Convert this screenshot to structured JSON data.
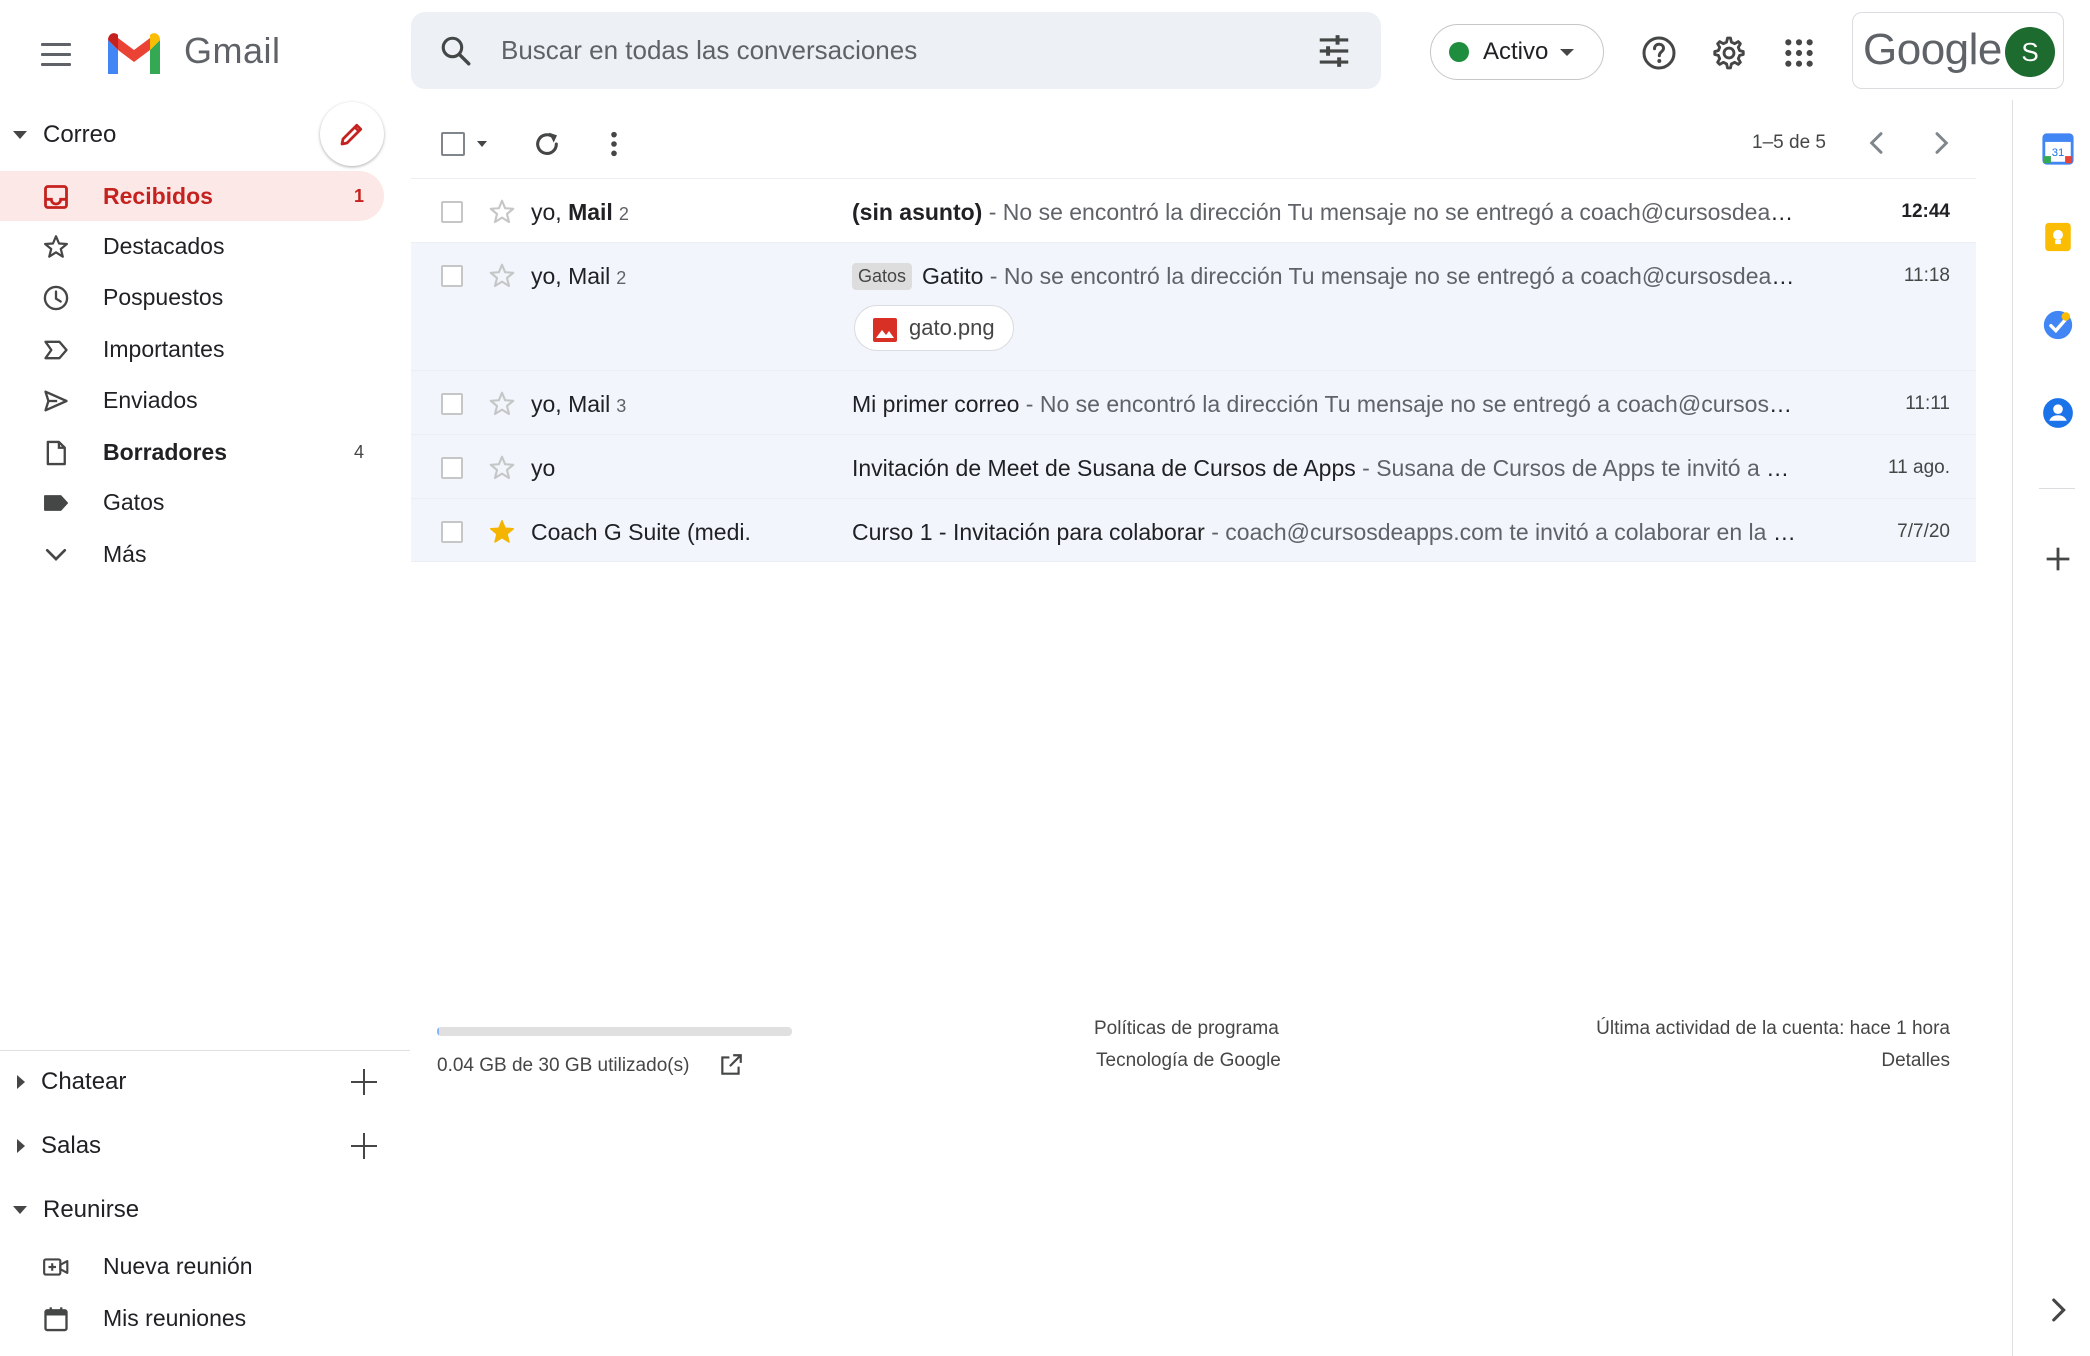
{
  "header": {
    "brand": "Gmail",
    "search_placeholder": "Buscar en todas las conversaciones",
    "status_label": "Activo",
    "account_word": "Google",
    "avatar_letter": "S"
  },
  "nav": {
    "mail_section": "Correo",
    "items": [
      {
        "label": "Recibidos",
        "count": "1"
      },
      {
        "label": "Destacados",
        "count": ""
      },
      {
        "label": "Pospuestos",
        "count": ""
      },
      {
        "label": "Importantes",
        "count": ""
      },
      {
        "label": "Enviados",
        "count": ""
      },
      {
        "label": "Borradores",
        "count": "4"
      },
      {
        "label": "Gatos",
        "count": ""
      },
      {
        "label": "Más",
        "count": ""
      }
    ],
    "chat_section": "Chatear",
    "rooms_section": "Salas",
    "meet_section": "Reunirse",
    "meet_items": [
      {
        "label": "Nueva reunión"
      },
      {
        "label": "Mis reuniones"
      }
    ]
  },
  "toolbar": {
    "pager": "1–5 de 5"
  },
  "emails": [
    {
      "sender": "yo, ",
      "sender_bold": "Mail",
      "count": "2",
      "label": "",
      "subject": "(sin asunto)",
      "snippet": " - No se encontró la dirección Tu mensaje no se entregó a coach@cursosdeapps.com porque no se encontró la dirección",
      "time": "12:44",
      "unread": true,
      "starred": false,
      "attachment": ""
    },
    {
      "sender": "yo, Mail",
      "sender_bold": "",
      "count": "2",
      "label": "Gatos",
      "subject": "Gatito",
      "snippet": " - No se encontró la dirección Tu mensaje no se entregó a coach@cursosdeapps.com porque no se encontró",
      "time": "11:18",
      "unread": false,
      "starred": false,
      "attachment": "gato.png"
    },
    {
      "sender": "yo, Mail",
      "sender_bold": "",
      "count": "3",
      "label": "",
      "subject": "Mi primer correo",
      "snippet": " - No se encontró la dirección Tu mensaje no se entregó a coach@cursosdeapps.com porque",
      "time": "11:11",
      "unread": false,
      "starred": false,
      "attachment": ""
    },
    {
      "sender": "yo",
      "sender_bold": "",
      "count": "",
      "label": "",
      "subject": "Invitación de Meet de Susana de Cursos de Apps",
      "snippet": " - Susana de Cursos de Apps te invitó a unirte a una reunión",
      "time": "11 ago.",
      "unread": false,
      "starred": false,
      "attachment": ""
    },
    {
      "sender": "Coach G Suite (medi.",
      "sender_bold": "",
      "count": "",
      "label": "",
      "subject": "Curso 1 - Invitación para colaborar",
      "snippet": " - coach@cursosdeapps.com te invitó a colaborar en la siguiente hoja",
      "time": "7/7/20",
      "unread": false,
      "starred": true,
      "attachment": ""
    }
  ],
  "footer": {
    "storage_text": "0.04 GB de 30 GB utilizado(s)",
    "storage_used_fraction": 0.0013,
    "program_policies": "Políticas de programa",
    "google_tech": "Tecnología de Google",
    "last_activity": "Última actividad de la cuenta: hace 1 hora",
    "details": "Detalles"
  },
  "sidepanel": {
    "calendar_day": "31"
  },
  "colors": {
    "accent_red": "#c5221f",
    "active_bg": "#fce8e6",
    "status_green": "#1e8e3e",
    "avatar_green": "#1e6b2f",
    "star_yellow": "#f4b400"
  },
  "icons": [
    "menu-icon",
    "search-icon",
    "tune-icon",
    "help-icon",
    "settings-icon",
    "apps-icon",
    "edit-icon",
    "inbox-icon",
    "star-icon",
    "clock-icon",
    "important-icon",
    "send-icon",
    "draft-icon",
    "label-icon",
    "chevron-down-icon",
    "video-add-icon",
    "calendar-icon",
    "refresh-icon",
    "more-vert-icon",
    "chevron-left-icon",
    "chevron-right-icon",
    "image-icon",
    "open-external-icon",
    "keep-icon",
    "tasks-icon",
    "contacts-icon",
    "plus-icon"
  ]
}
